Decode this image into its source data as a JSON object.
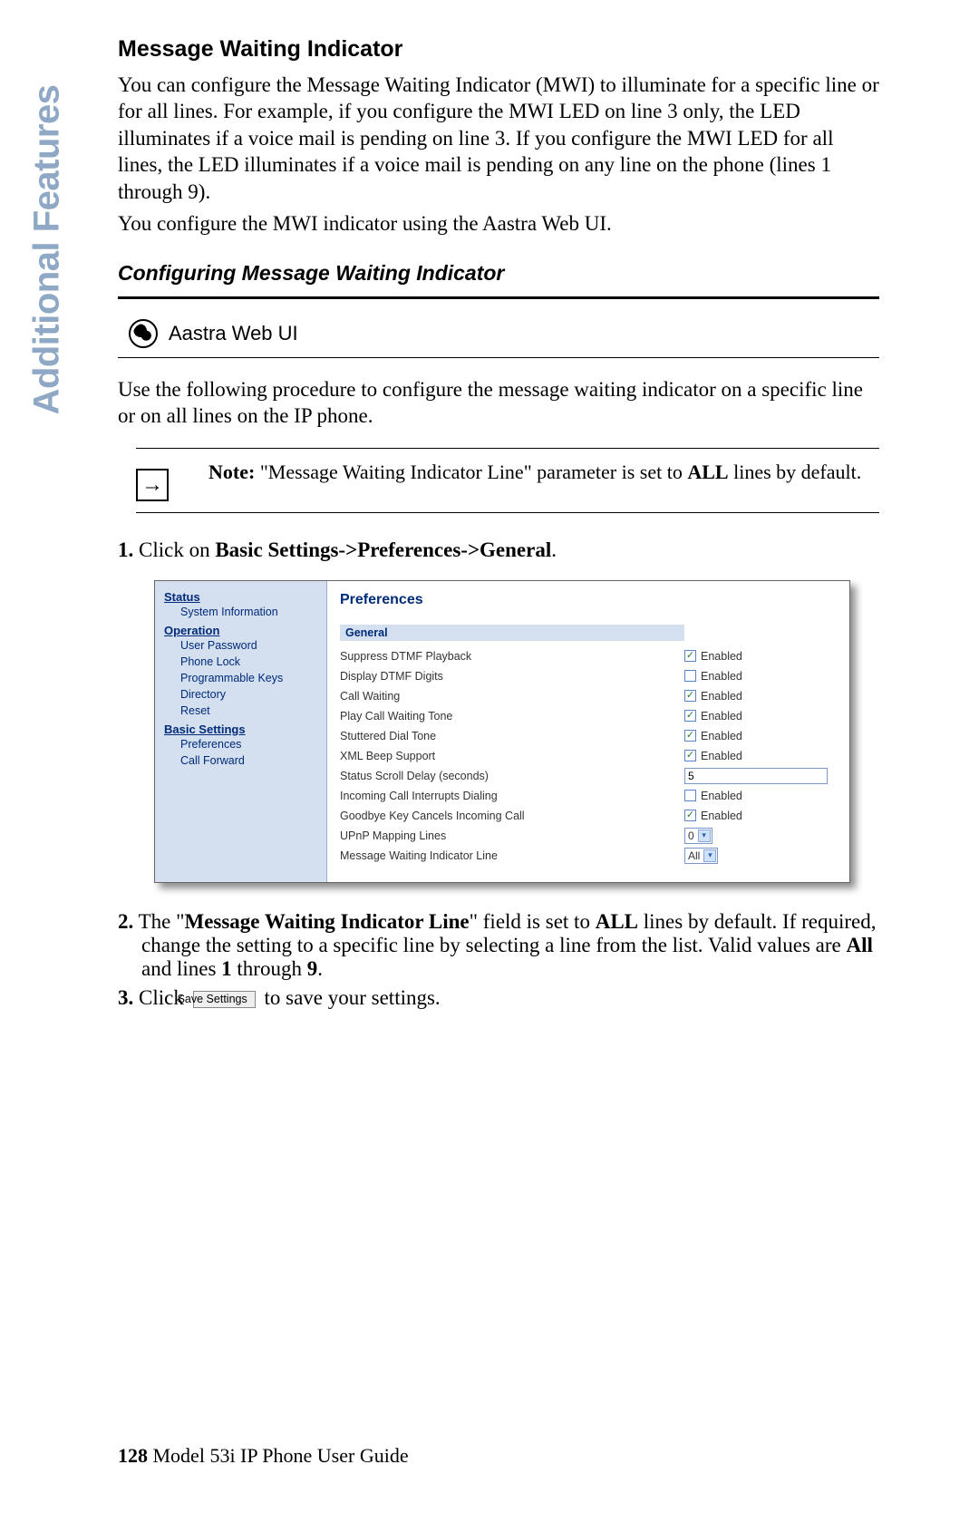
{
  "sidebar_tab": "Additional Features",
  "heading": "Message Waiting Indicator",
  "para1": "You can configure the Message Waiting Indicator (MWI) to illuminate for a specific line or for all lines. For example, if you configure the MWI LED on line 3 only, the LED illuminates if a voice mail is pending on line 3. If you configure the MWI LED for all lines, the LED illuminates if a voice mail is pending on any line on the phone (lines 1 through 9).",
  "para2": "You configure the MWI indicator using the Aastra Web UI.",
  "subheading": "Configuring Message Waiting Indicator",
  "webui_label": "Aastra Web UI",
  "intro_para": "Use the following procedure to configure the message waiting indicator on a specific line or on all lines on the IP phone.",
  "note": {
    "label": "Note:",
    "text_before": " \"Message Waiting Indicator Line\" parameter is set to ",
    "bold": "ALL",
    "text_after": " lines by default."
  },
  "steps": {
    "s1_num": "1.",
    "s1_pre": " Click on ",
    "s1_bold": "Basic Settings->Preferences->General",
    "s1_post": ".",
    "s2_num": "2.",
    "s2_text": " The \"<b>Message Waiting Indicator Line</b>\" field is set to <b>ALL</b> lines by default. If required, change the setting to a specific line by selecting a line from the list. Valid values are <b>All</b> and lines <b>1</b> through <b>9</b>.",
    "s3_num": "3.",
    "s3_pre": " Click ",
    "s3_post": " to save your settings."
  },
  "save_btn": "Save Settings",
  "screenshot": {
    "nav": {
      "status": "Status",
      "status_items": [
        "System Information"
      ],
      "operation": "Operation",
      "operation_items": [
        "User Password",
        "Phone Lock",
        "Programmable Keys",
        "Directory",
        "Reset"
      ],
      "basic": "Basic Settings",
      "basic_items": [
        "Preferences",
        "Call Forward"
      ]
    },
    "title": "Preferences",
    "group": "General",
    "rows": [
      {
        "label": "Suppress DTMF Playback",
        "type": "check",
        "checked": true,
        "txt": "Enabled"
      },
      {
        "label": "Display DTMF Digits",
        "type": "check",
        "checked": false,
        "txt": "Enabled"
      },
      {
        "label": "Call Waiting",
        "type": "check",
        "checked": true,
        "txt": "Enabled"
      },
      {
        "label": "Play Call Waiting Tone",
        "type": "check",
        "checked": true,
        "txt": "Enabled"
      },
      {
        "label": "Stuttered Dial Tone",
        "type": "check",
        "checked": true,
        "txt": "Enabled"
      },
      {
        "label": "XML Beep Support",
        "type": "check",
        "checked": true,
        "txt": "Enabled"
      },
      {
        "label": "Status Scroll Delay (seconds)",
        "type": "input",
        "value": "5"
      },
      {
        "label": "Incoming Call Interrupts Dialing",
        "type": "check",
        "checked": false,
        "txt": "Enabled"
      },
      {
        "label": "Goodbye Key Cancels Incoming Call",
        "type": "check",
        "checked": true,
        "txt": "Enabled"
      },
      {
        "label": "UPnP Mapping Lines",
        "type": "select",
        "value": "0"
      },
      {
        "label": "Message Waiting Indicator Line",
        "type": "select",
        "value": "All"
      }
    ]
  },
  "footer": {
    "page": "128",
    "title": " Model 53i IP Phone User Guide"
  }
}
